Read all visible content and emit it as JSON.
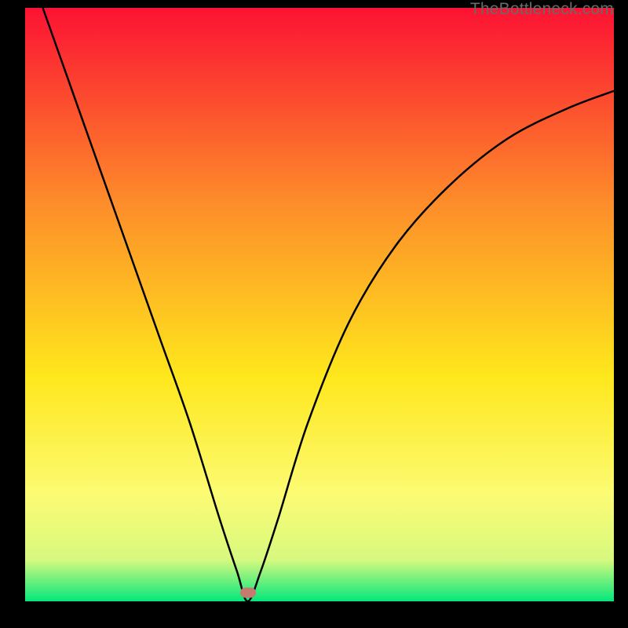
{
  "watermark": "TheBottleneck.com",
  "colors": {
    "top": "#fc1233",
    "mid1": "#fd8d2a",
    "mid2": "#fee71c",
    "mid3": "#fcfb73",
    "near_bottom": "#d7f97f",
    "bottom": "#03e77c",
    "curve": "#000000",
    "marker": "#c77a70",
    "background": "#000000"
  },
  "marker": {
    "x_frac": 0.378,
    "y_frac": 0.985
  },
  "chart_data": {
    "type": "line",
    "title": "",
    "xlabel": "",
    "ylabel": "",
    "xlim": [
      0,
      1
    ],
    "ylim": [
      0,
      1
    ],
    "series": [
      {
        "name": "bottleneck-curve",
        "x": [
          0.03,
          0.08,
          0.13,
          0.18,
          0.23,
          0.28,
          0.33,
          0.36,
          0.378,
          0.4,
          0.43,
          0.48,
          0.55,
          0.63,
          0.72,
          0.82,
          0.92,
          1.0
        ],
        "y": [
          1.0,
          0.86,
          0.72,
          0.58,
          0.44,
          0.3,
          0.14,
          0.05,
          0.0,
          0.05,
          0.14,
          0.3,
          0.47,
          0.6,
          0.7,
          0.78,
          0.83,
          0.86
        ]
      }
    ],
    "optimum_point": {
      "x": 0.378,
      "y": 0.0
    },
    "background_gradient": {
      "direction": "vertical",
      "stops": [
        {
          "pos": 0.0,
          "color": "#fc1233"
        },
        {
          "pos": 0.33,
          "color": "#fd8d2a"
        },
        {
          "pos": 0.62,
          "color": "#fee71c"
        },
        {
          "pos": 0.82,
          "color": "#fcfb73"
        },
        {
          "pos": 0.93,
          "color": "#d7f97f"
        },
        {
          "pos": 1.0,
          "color": "#03e77c"
        }
      ]
    }
  }
}
